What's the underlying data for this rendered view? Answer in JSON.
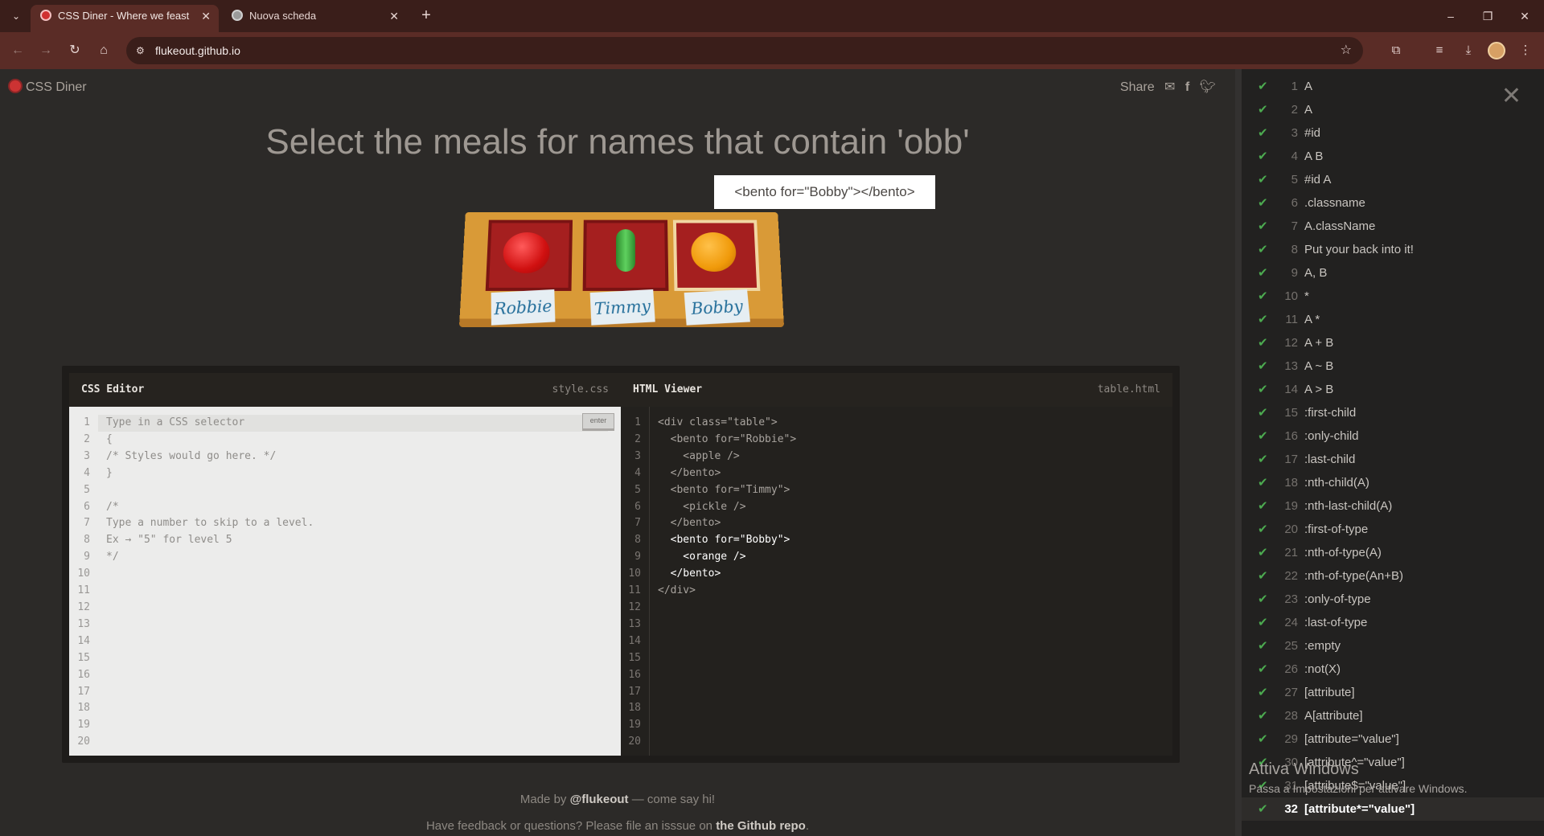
{
  "browser": {
    "tabs": [
      {
        "title": "CSS Diner - Where we feast on",
        "favicon_color": "#d03030"
      },
      {
        "title": "Nuova scheda",
        "favicon_color": "#9a9a9a"
      }
    ],
    "url": "flukeout.github.io"
  },
  "page": {
    "logo": "CSS Diner",
    "share_label": "Share",
    "instruction": "Select the meals for names that contain 'obb'",
    "tooltip": "<bento for=\"Bobby\"></bento>",
    "nametags": [
      "Robbie",
      "Timmy",
      "Bobby"
    ],
    "css_editor": {
      "title": "CSS Editor",
      "file": "style.css",
      "enter_label": "enter",
      "line_numbers": [
        "1",
        "2",
        "3",
        "4",
        "5",
        "6",
        "7",
        "8",
        "9",
        "10",
        "11",
        "12",
        "13",
        "14",
        "15",
        "16",
        "17",
        "18",
        "19",
        "20"
      ],
      "placeholder": "Type in a CSS selector",
      "code": "{\n/* Styles would go here. */\n}\n\n/*\nType a number to skip to a level.\nEx → \"5\" for level 5\n*/"
    },
    "html_viewer": {
      "title": "HTML Viewer",
      "file": "table.html",
      "line_numbers": [
        "1",
        "2",
        "3",
        "4",
        "5",
        "6",
        "7",
        "8",
        "9",
        "10",
        "11",
        "12",
        "13",
        "14",
        "15",
        "16",
        "17",
        "18",
        "19",
        "20"
      ],
      "lines": [
        "<div class=\"table\">",
        "  <bento for=\"Robbie\">",
        "    <apple />",
        "  </bento>",
        "  <bento for=\"Timmy\">",
        "    <pickle />",
        "  </bento>",
        "  <bento for=\"Bobby\">",
        "    <orange />",
        "  </bento>",
        "</div>"
      ]
    },
    "footer": {
      "made_by_prefix": "Made by",
      "made_by_handle": "@flukeout",
      "made_by_suffix": "— come say hi!",
      "feedback_prefix": "Have feedback or questions? Please file an isssue on",
      "feedback_link": "the Github repo",
      "feedback_suffix": "."
    }
  },
  "sidebar": {
    "levels": [
      {
        "num": "1",
        "label": "A"
      },
      {
        "num": "2",
        "label": "A"
      },
      {
        "num": "3",
        "label": "#id"
      },
      {
        "num": "4",
        "label": "A B"
      },
      {
        "num": "5",
        "label": "#id A"
      },
      {
        "num": "6",
        "label": ".classname"
      },
      {
        "num": "7",
        "label": "A.className"
      },
      {
        "num": "8",
        "label": "Put your back into it!"
      },
      {
        "num": "9",
        "label": "A, B"
      },
      {
        "num": "10",
        "label": "*"
      },
      {
        "num": "11",
        "label": "A *"
      },
      {
        "num": "12",
        "label": "A + B"
      },
      {
        "num": "13",
        "label": "A ~ B"
      },
      {
        "num": "14",
        "label": "A > B"
      },
      {
        "num": "15",
        "label": ":first-child"
      },
      {
        "num": "16",
        "label": ":only-child"
      },
      {
        "num": "17",
        "label": ":last-child"
      },
      {
        "num": "18",
        "label": ":nth-child(A)"
      },
      {
        "num": "19",
        "label": ":nth-last-child(A)"
      },
      {
        "num": "20",
        "label": ":first-of-type"
      },
      {
        "num": "21",
        "label": ":nth-of-type(A)"
      },
      {
        "num": "22",
        "label": ":nth-of-type(An+B)"
      },
      {
        "num": "23",
        "label": ":only-of-type"
      },
      {
        "num": "24",
        "label": ":last-of-type"
      },
      {
        "num": "25",
        "label": ":empty"
      },
      {
        "num": "26",
        "label": ":not(X)"
      },
      {
        "num": "27",
        "label": "[attribute]"
      },
      {
        "num": "28",
        "label": "A[attribute]"
      },
      {
        "num": "29",
        "label": "[attribute=\"value\"]"
      },
      {
        "num": "30",
        "label": "[attribute^=\"value\"]"
      },
      {
        "num": "31",
        "label": "[attribute$=\"value\"]"
      },
      {
        "num": "32",
        "label": "[attribute*=\"value\"]"
      }
    ],
    "current_level": "32",
    "check_color": "#4caa50"
  },
  "os_watermark": {
    "line1": "Attiva Windows",
    "line2": "Passa a Impostazioni per attivare Windows."
  }
}
